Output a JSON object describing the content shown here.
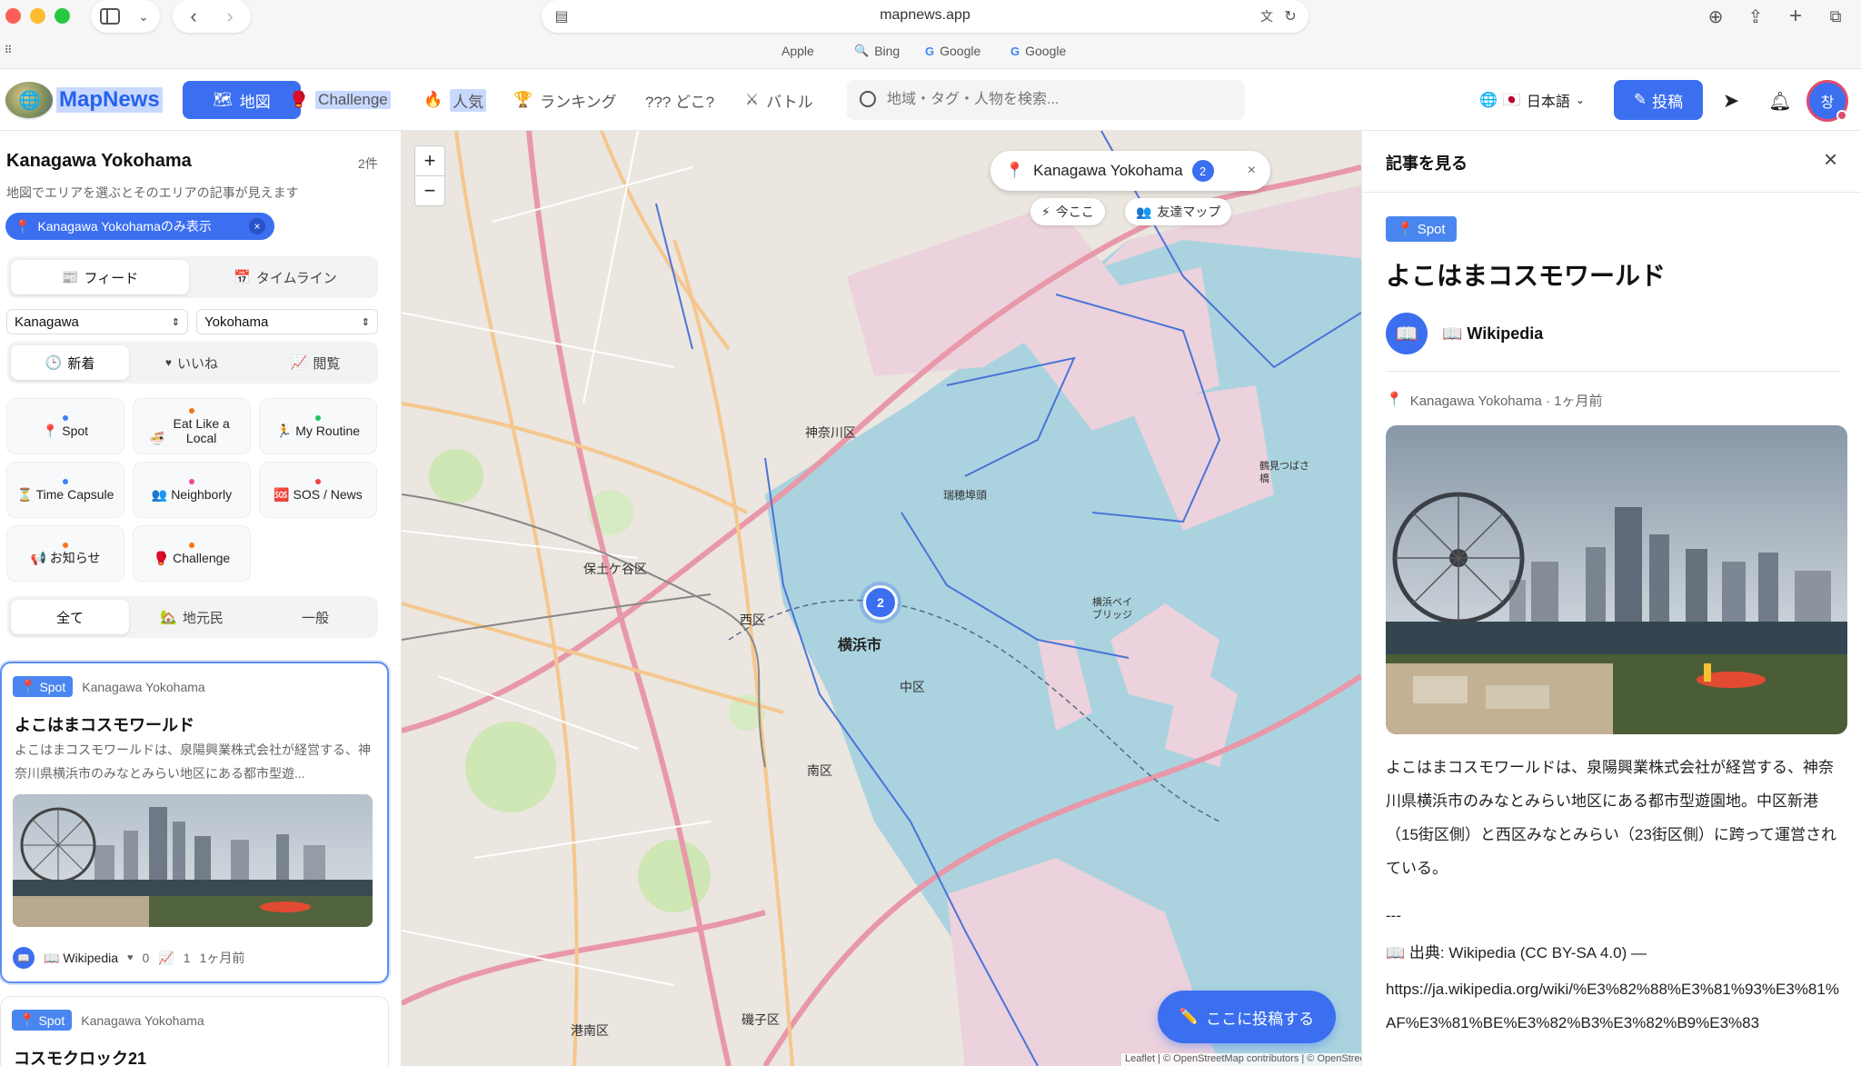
{
  "browser": {
    "address": "mapnews.app",
    "favorites": [
      {
        "icon": "",
        "label": "Apple"
      },
      {
        "icon": "🔍",
        "label": "Bing"
      },
      {
        "icon": "G",
        "label": "Google"
      },
      {
        "icon": "G",
        "label": "Google"
      }
    ]
  },
  "nav": {
    "brand": "MapNews",
    "items": [
      {
        "icon": "🗺",
        "label": "地図"
      },
      {
        "icon": "🥊",
        "label": "Challenge"
      },
      {
        "icon": "🔥",
        "label": "人気"
      },
      {
        "icon": "🏆",
        "label": "ランキング"
      },
      {
        "icon": "",
        "label": "??? どこ?"
      },
      {
        "icon": "⚔",
        "label": "バトル"
      }
    ],
    "search_placeholder": "地域・タグ・人物を検索...",
    "language": "日本語",
    "post_label": "投稿",
    "avatar": "창"
  },
  "sidebar": {
    "title": "Kanagawa Yokohama",
    "count": "2件",
    "subtitle": "地図でエリアを選ぶとそのエリアの記事が見えます",
    "filter_chip": "Kanagawa Yokohamaのみ表示",
    "view_tabs": [
      {
        "icon": "📰",
        "label": "フィード"
      },
      {
        "icon": "📅",
        "label": "タイムライン"
      }
    ],
    "prefecture": "Kanagawa",
    "city": "Yokohama",
    "sort_tabs": [
      {
        "icon": "🕒",
        "label": "新着"
      },
      {
        "icon": "♥",
        "label": "いいね"
      },
      {
        "icon": "📈",
        "label": "閲覧"
      }
    ],
    "categories": [
      {
        "icon": "📍",
        "label": "Spot",
        "dot": "#3b82f6"
      },
      {
        "icon": "🍜",
        "label": "Eat Like a Local",
        "dot": "#f97316"
      },
      {
        "icon": "🏃",
        "label": "My Routine",
        "dot": "#22c55e"
      },
      {
        "icon": "⏳",
        "label": "Time Capsule",
        "dot": "#3b82f6"
      },
      {
        "icon": "👥",
        "label": "Neighborly",
        "dot": "#ec4899"
      },
      {
        "icon": "🆘",
        "label": "SOS / News",
        "dot": "#ef4444"
      },
      {
        "icon": "📢",
        "label": "お知らせ",
        "dot": "#f97316"
      },
      {
        "icon": "🥊",
        "label": "Challenge",
        "dot": "#f97316"
      }
    ],
    "audience_tabs": [
      {
        "icon": "",
        "label": "全て"
      },
      {
        "icon": "🏡",
        "label": "地元民"
      },
      {
        "icon": "",
        "label": "一般"
      }
    ],
    "cards": [
      {
        "badge": "Spot",
        "location": "Kanagawa Yokohama",
        "title": "よこはまコスモワールド",
        "excerpt": "よこはまコスモワールドは、泉陽興業株式会社が経営する、神奈川県横浜市のみなとみらい地区にある都市型遊...",
        "source": "📖 Wikipedia",
        "likes": "0",
        "views": "1",
        "time": "1ヶ月前"
      },
      {
        "badge": "Spot",
        "location": "Kanagawa Yokohama",
        "title": "コスモクロック21"
      }
    ]
  },
  "map": {
    "location_chip": "Kanagawa Yokohama",
    "location_count": "2",
    "now_label": "今ここ",
    "friends_label": "友達マップ",
    "cluster_count": "2",
    "post_here": "ここに投稿する",
    "attribution": "Leaflet | © OpenStreetMap contributors | © OpenStreetMap (ODbL) · osmBoundaries",
    "labels": [
      {
        "text": "神奈川区"
      },
      {
        "text": "保土ケ谷区"
      },
      {
        "text": "西区"
      },
      {
        "text": "横浜市"
      },
      {
        "text": "中区"
      },
      {
        "text": "南区"
      },
      {
        "text": "磯子区"
      },
      {
        "text": "港南区"
      },
      {
        "text": "瑞穂埠頭"
      },
      {
        "text": "横浜ベイブリッジ"
      },
      {
        "text": "鶴見つばさ橋"
      }
    ]
  },
  "panel": {
    "header": "記事を見る",
    "badge": "Spot",
    "title": "よこはまコスモワールド",
    "author": "📖 Wikipedia",
    "meta": "Kanagawa Yokohama · 1ヶ月前",
    "body": "よこはまコスモワールドは、泉陽興業株式会社が経営する、神奈川県横浜市のみなとみらい地区にある都市型遊園地。中区新港（15街区側）と西区みなとみらい（23街区側）に跨って運営されている。",
    "divider": "---",
    "source": "📖 出典: Wikipedia (CC BY-SA 4.0) —",
    "url": "https://ja.wikipedia.org/wiki/%E3%82%88%E3%81%93%E3%81%AF%E3%81%BE%E3%82%B3%E3%82%B9%E3%83"
  }
}
